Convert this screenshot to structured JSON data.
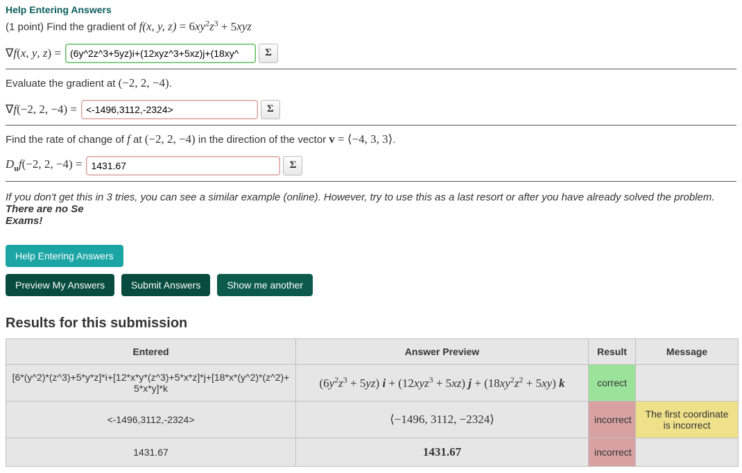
{
  "help_link": "Help Entering Answers",
  "problem": {
    "points_prefix": "(1 point) Find the gradient of ",
    "func_lhs": "f(x, y, z) = ",
    "func_rhs_html": "6xy²z³ + 5xyz"
  },
  "q1": {
    "label_html": "∇f(x, y, z) =",
    "value": "(6y^2z^3+5yz)i+(12xyz^3+5xz)j+(18xy^",
    "sigma": "Σ"
  },
  "inter1": {
    "text": "Evaluate the gradient at ",
    "point": "(−2, 2, −4)",
    "suffix": "."
  },
  "q2": {
    "label_html": "∇f(−2, 2, −4) =",
    "value": "<-1496,3112,-2324>",
    "sigma": "Σ"
  },
  "inter2": {
    "pre": "Find the rate of change of ",
    "f": "f",
    "mid": " at ",
    "point": "(−2, 2, −4)",
    "dir": " in the direction of the vector ",
    "vec_label": "v",
    "eq": " = ",
    "vec_val": "⟨−4, 3, 3⟩",
    "suffix": "."
  },
  "q3": {
    "label_html": "D𝐮 f(−2, 2, −4) =",
    "value": "1431.67",
    "sigma": "Σ"
  },
  "note": {
    "italic": "If you don't get this in 3 tries, you can see a similar example (online). However, try to use this as a last resort or after you have already solved the problem. ",
    "bold": "There are no Second chances on Exams!",
    "bold_visible": "There are no Se",
    "bold_line2": "Exams!"
  },
  "buttons": {
    "help": "Help Entering Answers",
    "preview": "Preview My Answers",
    "submit": "Submit Answers",
    "another": "Show me another"
  },
  "results": {
    "heading": "Results for this submission",
    "headers": {
      "entered": "Entered",
      "preview": "Answer Preview",
      "result": "Result",
      "message": "Message"
    },
    "rows": [
      {
        "entered": "[6*(y^2)*(z^3)+5*y*z]*i+[12*x*y*(z^3)+5*x*z]*j+[18*x*(y^2)*(z^2)+5*x*y]*k",
        "preview_html": "(6y²z³ + 5yz) 𝒊 + (12xyz³ + 5xz) 𝒋 + (18xy²z² + 5xy) 𝒌",
        "result": "correct",
        "message": ""
      },
      {
        "entered": "<-1496,3112,-2324>",
        "preview_html": "⟨−1496, 3112, −2324⟩",
        "result": "incorrect",
        "message": "The first coordinate is incorrect"
      },
      {
        "entered": "1431.67",
        "preview_html": "1431.67",
        "result": "incorrect",
        "message": ""
      }
    ]
  }
}
